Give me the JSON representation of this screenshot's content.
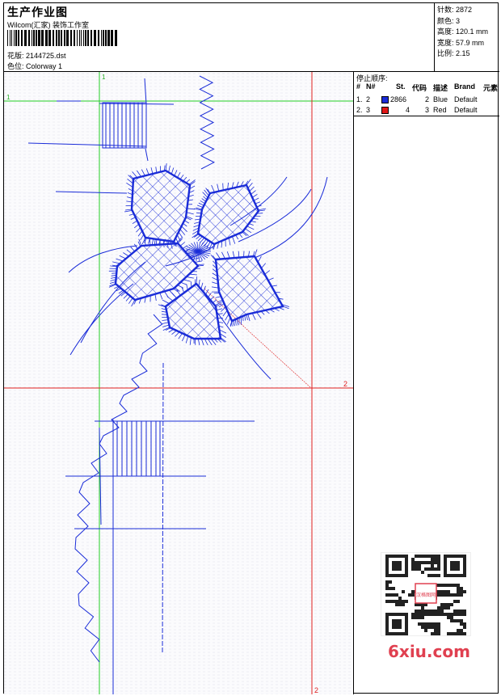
{
  "header": {
    "title": "生产作业图",
    "company": "Wilcom(汇家) 装饰工作室",
    "design_label": "花版: 2144725.dst",
    "colorway_label": "色位:  Colorway 1"
  },
  "stats": {
    "stitches": "针数: 2872",
    "colors": "颜色: 3",
    "height": "高度: 120.1 mm",
    "width": "宽度: 57.9 mm",
    "scale": "比例: 2.15"
  },
  "stops": {
    "title": "停止顺序:",
    "headers": [
      "#",
      "N#",
      "St.",
      "代码",
      "描述",
      "Brand",
      "元素"
    ],
    "rows": [
      {
        "index": "1.",
        "n": "2",
        "st": "2866",
        "code": "2",
        "desc": "Blue",
        "brand": "Default",
        "color": "#1a2cd8"
      },
      {
        "index": "2.",
        "n": "3",
        "st": "4",
        "code": "3",
        "desc": "Red",
        "brand": "Default",
        "color": "#e01818"
      }
    ]
  },
  "guides": {
    "green_label_top": "1",
    "green_label_left": "1",
    "red_label_right": "2",
    "red_label_bottom": "2"
  },
  "watermark": {
    "text": "6xiu.com",
    "qr_badge": "汉格图网"
  },
  "colors": {
    "thread_blue": "#1a2cd8",
    "thread_red": "#e01818",
    "guide_green": "#22cc22",
    "guide_red": "#e02020"
  }
}
